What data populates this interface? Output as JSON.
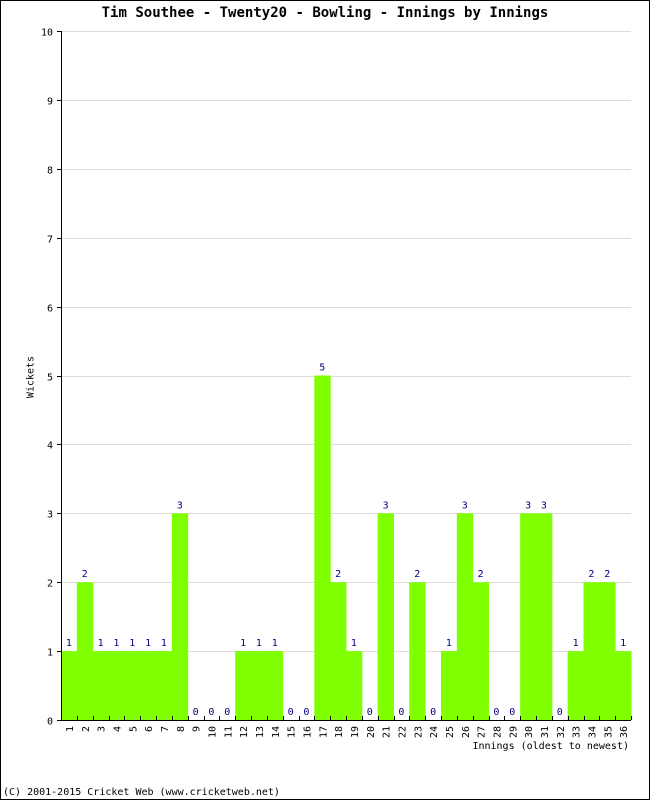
{
  "chart_data": {
    "type": "bar",
    "title": "Tim Southee - Twenty20 - Bowling - Innings by Innings",
    "xlabel": "Innings (oldest to newest)",
    "ylabel": "Wickets",
    "ylim": [
      0,
      10
    ],
    "yticks": [
      0,
      1,
      2,
      3,
      4,
      5,
      6,
      7,
      8,
      9,
      10
    ],
    "grid": true,
    "bar_color": "#80ff00",
    "label_color": "#000080",
    "grid_color": "#dddddd",
    "categories": [
      "1",
      "2",
      "3",
      "4",
      "5",
      "6",
      "7",
      "8",
      "9",
      "10",
      "11",
      "12",
      "13",
      "14",
      "15",
      "16",
      "17",
      "18",
      "19",
      "20",
      "21",
      "22",
      "23",
      "24",
      "25",
      "26",
      "27",
      "28",
      "29",
      "30",
      "31",
      "32",
      "33",
      "34",
      "35",
      "36"
    ],
    "values": [
      1,
      2,
      1,
      1,
      1,
      1,
      1,
      3,
      0,
      0,
      0,
      1,
      1,
      1,
      0,
      0,
      5,
      2,
      1,
      0,
      3,
      0,
      2,
      0,
      1,
      3,
      2,
      0,
      0,
      3,
      3,
      0,
      1,
      2,
      2,
      1
    ]
  },
  "footer": "(C) 2001-2015 Cricket Web (www.cricketweb.net)"
}
